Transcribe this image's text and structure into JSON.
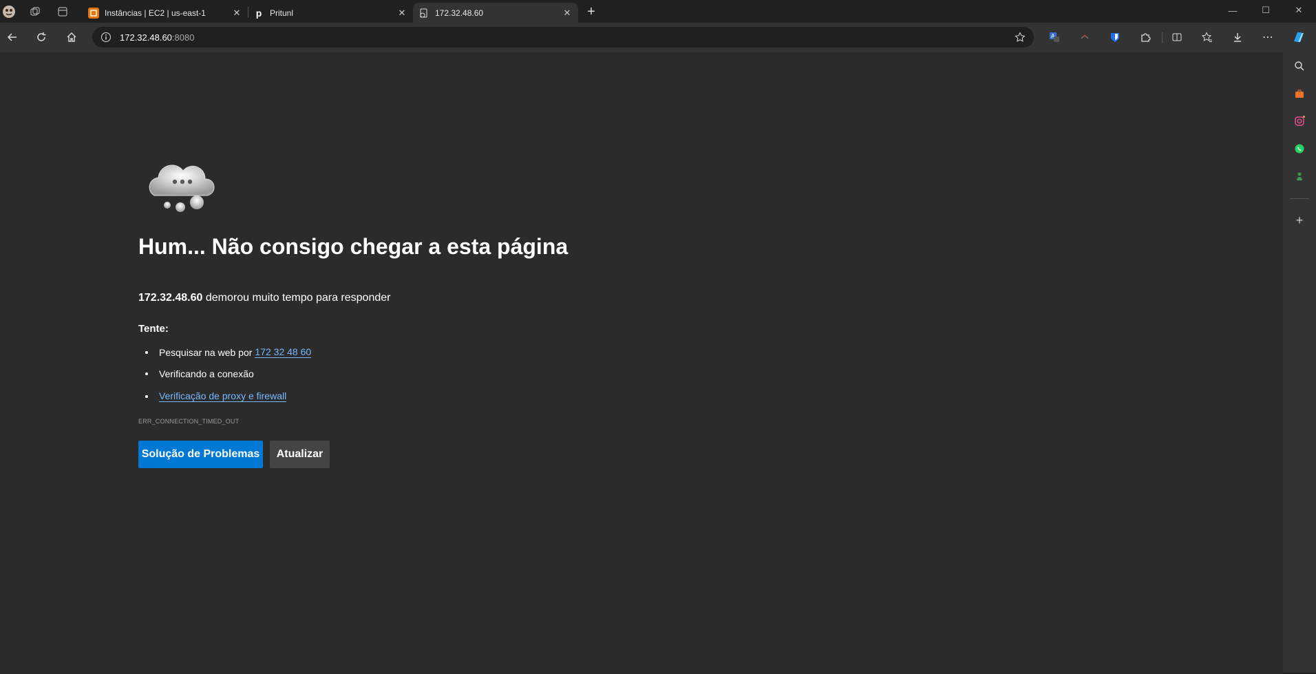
{
  "tabs": [
    {
      "title": "Instâncias | EC2 | us-east-1",
      "icon": "aws-icon"
    },
    {
      "title": "Pritunl",
      "icon": "pritunl-icon",
      "icon_letter": "p"
    },
    {
      "title": "172.32.48.60",
      "icon": "error-page-icon",
      "active": true
    }
  ],
  "address": {
    "host": "172.32.48.60",
    "port": ":8080"
  },
  "error": {
    "title": "Hum... Não consigo chegar a esta página",
    "host": "172.32.48.60",
    "message": " demorou muito tempo para responder",
    "try_label": "Tente:",
    "suggestion1_prefix": "Pesquisar na web por",
    "suggestion1_link": "172 32 48 60",
    "suggestion2": "Verificando a conexão",
    "suggestion3_link": "Verificação de proxy e firewall",
    "code": "ERR_CONNECTION_TIMED_OUT",
    "troubleshoot_button": "Solução de Problemas",
    "refresh_button": "Atualizar"
  },
  "colors": {
    "accent": "#0078d4",
    "link": "#79b8ff",
    "page_bg": "#2b2b2b",
    "chrome_bg": "#202020"
  }
}
